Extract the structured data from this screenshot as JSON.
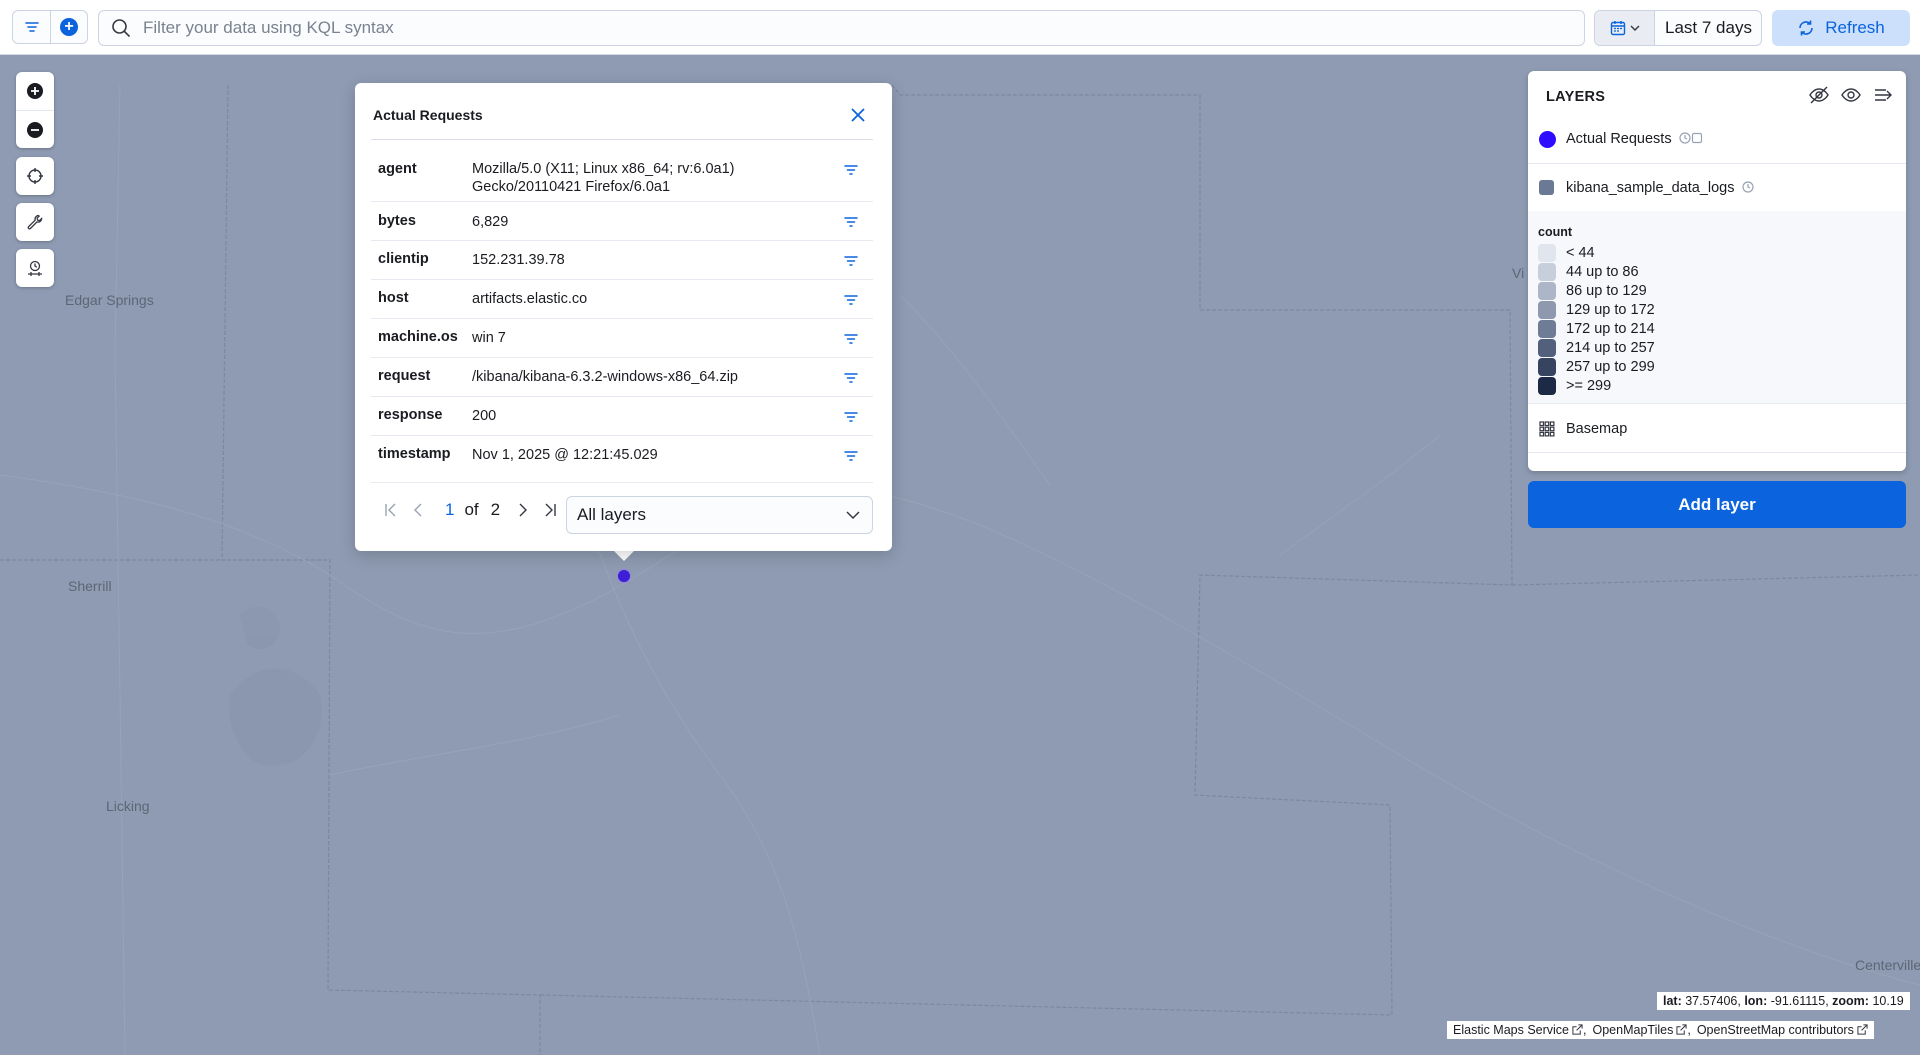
{
  "query_bar": {
    "search_placeholder": "Filter your data using KQL syntax",
    "time_range": "Last 7 days",
    "refresh_label": "Refresh"
  },
  "map": {
    "places": [
      "Edgar Springs",
      "Sherrill",
      "Licking",
      "Centerville",
      "Vi"
    ]
  },
  "popup": {
    "title": "Actual Requests",
    "rows": [
      {
        "key": "agent",
        "value_line1": "Mozilla/5.0 (X11; Linux x86_64; rv:6.0a1)",
        "value_line2": "Gecko/20110421 Firefox/6.0a1"
      },
      {
        "key": "bytes",
        "value": "6,829"
      },
      {
        "key": "clientip",
        "value": "152.231.39.78"
      },
      {
        "key": "host",
        "value": "artifacts.elastic.co"
      },
      {
        "key": "machine.os",
        "value": "win 7"
      },
      {
        "key": "request",
        "value": "/kibana/kibana-6.3.2-windows-x86_64.zip"
      },
      {
        "key": "response",
        "value": "200"
      },
      {
        "key": "timestamp",
        "value": "Nov 1, 2025 @ 12:21:45.029"
      }
    ],
    "pager": {
      "current": "1",
      "of": "of",
      "total": "2"
    },
    "layer_select": "All layers"
  },
  "layers_panel": {
    "title": "LAYERS",
    "layers": [
      {
        "name": "Actual Requests",
        "color": "#2f0bff"
      },
      {
        "name": "kibana_sample_data_logs",
        "color": "#6a7a95"
      },
      {
        "name": "Basemap"
      }
    ],
    "legend": {
      "title": "count",
      "items": [
        {
          "label": "< 44",
          "color": "#e1e5ee"
        },
        {
          "label": "44 up to 86",
          "color": "#c7cedc"
        },
        {
          "label": "86 up to 129",
          "color": "#adb6c9"
        },
        {
          "label": "129 up to 172",
          "color": "#8e99b0"
        },
        {
          "label": "172 up to 214",
          "color": "#6f7c96"
        },
        {
          "label": "214 up to 257",
          "color": "#52607b"
        },
        {
          "label": "257 up to 299",
          "color": "#364460"
        },
        {
          "label": ">= 299",
          "color": "#1c2a45"
        }
      ]
    },
    "add_layer_label": "Add layer"
  },
  "status": {
    "lat_label": "lat:",
    "lat": "37.57406",
    "lon_label": "lon:",
    "lon": "-91.61115",
    "zoom_label": "zoom:",
    "zoom": "10.19",
    "attribution": [
      "Elastic Maps Service",
      "OpenMapTiles",
      "OpenStreetMap contributors"
    ]
  },
  "colors": {
    "accent": "#0b64dd",
    "map_background": "#8e9bb2"
  }
}
